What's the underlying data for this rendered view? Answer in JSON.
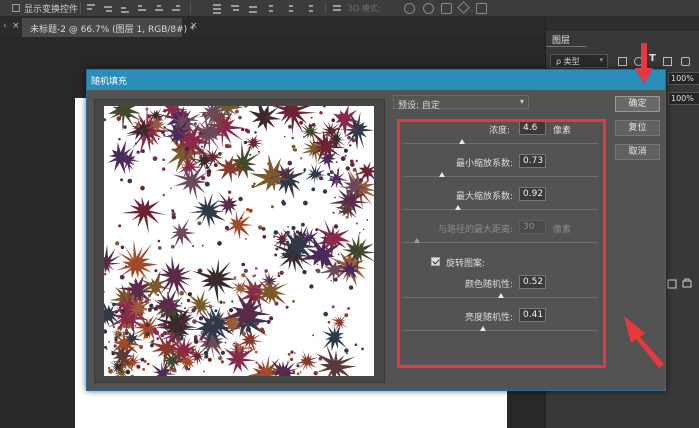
{
  "options_bar": {
    "show_transform_label": "显示变换控件",
    "mode_3d_label": "3D 模式:"
  },
  "tab_bar": {
    "close_glyph": "×",
    "document_tab_title": "未标题-2 @ 66.7% (图层 1, RGB/8#) *"
  },
  "layers_panel": {
    "title": "图层",
    "kind_filter": "ρ 类型",
    "text_filter_icon": "T",
    "opacity_value": "100%",
    "fill_value": "100%"
  },
  "dialog": {
    "title": "随机填充",
    "preset_label": "预设: 自定",
    "buttons": {
      "ok": "确定",
      "reset": "复位",
      "cancel": "取消"
    },
    "params": [
      {
        "label": "浓度:",
        "value": "4.6",
        "unit": "像素",
        "slider_fraction": 0.3
      },
      {
        "label": "最小缩放系数:",
        "value": "0.73",
        "unit": "",
        "slider_fraction": 0.2
      },
      {
        "label": "最大缩放系数:",
        "value": "0.92",
        "unit": "",
        "slider_fraction": 0.28
      },
      {
        "label": "与路径的最大距离:",
        "value": "30",
        "unit": "像素",
        "slider_fraction": 0.07,
        "disabled": true
      },
      {
        "label": "颜色随机性:",
        "value": "0.52",
        "unit": "",
        "slider_fraction": 0.5
      },
      {
        "label": "亮度随机性:",
        "value": "0.41",
        "unit": "",
        "slider_fraction": 0.41
      }
    ],
    "rotate_pattern_label": "旋转图案:",
    "rotate_pattern_checked": true
  },
  "colors": {
    "title_bar": "#2a8dba",
    "annotation_red": "#e8383e"
  },
  "icons": [
    "checkbox-icon",
    "align-icon",
    "3d-orbit-icon",
    "chevron-down-icon",
    "checkmark-icon",
    "red-arrow-annotation"
  ]
}
